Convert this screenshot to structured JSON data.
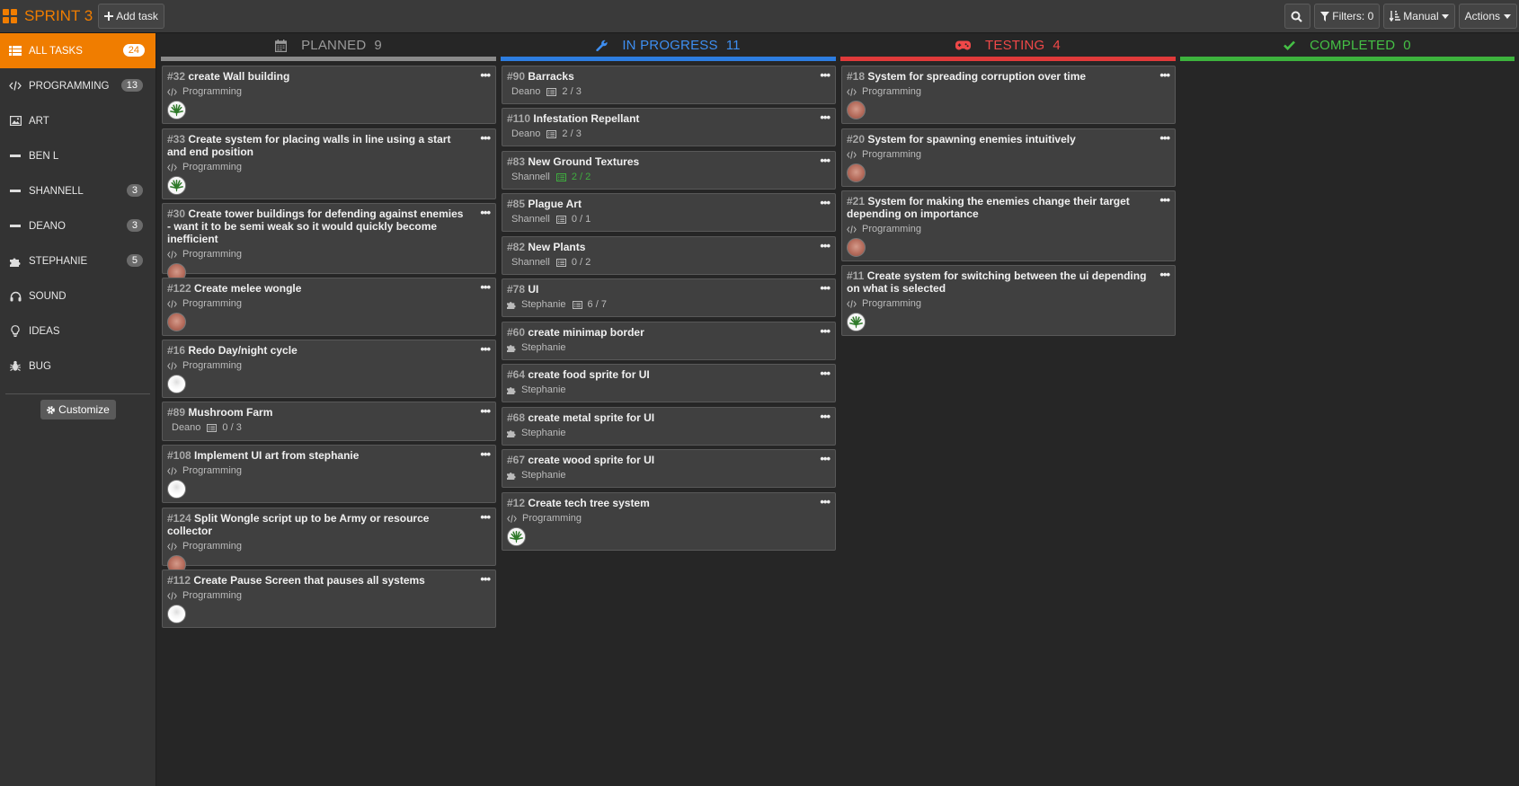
{
  "app": {
    "title": "SPRINT 3",
    "add_task": "Add task",
    "filters": "Filters: 0",
    "sort": "Manual",
    "actions": "Actions"
  },
  "sidebar": {
    "items": [
      {
        "label": "ALL TASKS",
        "count": "24",
        "icon": "table-icon",
        "active": true
      },
      {
        "label": "PROGRAMMING",
        "count": "13",
        "icon": "code-icon"
      },
      {
        "label": "ART",
        "count": "",
        "icon": "image-icon"
      },
      {
        "label": "BEN L",
        "count": "",
        "icon": "minus-icon"
      },
      {
        "label": "SHANNELL",
        "count": "3",
        "icon": "minus-icon"
      },
      {
        "label": "DEANO",
        "count": "3",
        "icon": "minus-icon"
      },
      {
        "label": "STEPHANIE",
        "count": "5",
        "icon": "puzzle-icon"
      },
      {
        "label": "SOUND",
        "count": "",
        "icon": "headphones-icon"
      },
      {
        "label": "IDEAS",
        "count": "",
        "icon": "lightbulb-icon"
      },
      {
        "label": "BUG",
        "count": "",
        "icon": "bug-icon"
      }
    ],
    "customize": "Customize"
  },
  "columns": [
    {
      "title": "PLANNED",
      "count": "9",
      "color": "#8a8a8a",
      "text_color": "#9a9a9a",
      "icon": "calendar-icon"
    },
    {
      "title": "IN PROGRESS",
      "count": "11",
      "color": "#2d7de0",
      "text_color": "#3e8ef0",
      "icon": "wrench-icon"
    },
    {
      "title": "TESTING",
      "count": "4",
      "color": "#e03a3a",
      "text_color": "#f04848",
      "icon": "gamepad-icon"
    },
    {
      "title": "COMPLETED",
      "count": "0",
      "color": "#3db33d",
      "text_color": "#45c045",
      "icon": "check-icon"
    }
  ],
  "cards": {
    "planned": [
      {
        "num": "#32",
        "title": "create Wall building",
        "tag": "Programming",
        "tag_icon": "code",
        "avatar": "weed"
      },
      {
        "num": "#33",
        "title": "Create system for placing walls in line using a start and end position",
        "tag": "Programming",
        "tag_icon": "code",
        "avatar": "weed"
      },
      {
        "num": "#30",
        "title": "Create tower buildings for defending against enemies - want it to be semi weak so it would quickly become inefficient",
        "tag": "Programming",
        "tag_icon": "code",
        "avatar": "face"
      },
      {
        "num": "#122",
        "title": "Create melee wongle",
        "tag": "Programming",
        "tag_icon": "code",
        "avatar": "face"
      },
      {
        "num": "#16",
        "title": "Redo Day/night cycle",
        "tag": "Programming",
        "tag_icon": "code",
        "avatar": "white"
      },
      {
        "num": "#89",
        "title": "Mushroom Farm",
        "tag": "Deano",
        "tag_icon": "none",
        "checklist": "0 / 3"
      },
      {
        "num": "#108",
        "title": "Implement UI art from stephanie",
        "tag": "Programming",
        "tag_icon": "code",
        "avatar": "white"
      },
      {
        "num": "#124",
        "title": "Split Wongle script up to be Army or resource collector",
        "tag": "Programming",
        "tag_icon": "code",
        "avatar": "face"
      },
      {
        "num": "#112",
        "title": "Create Pause Screen that pauses all systems",
        "tag": "Programming",
        "tag_icon": "code",
        "avatar": "white"
      }
    ],
    "in_progress": [
      {
        "num": "#90",
        "title": "Barracks",
        "tag": "Deano",
        "tag_icon": "none",
        "checklist": "2 / 3"
      },
      {
        "num": "#110",
        "title": "Infestation Repellant",
        "tag": "Deano",
        "tag_icon": "none",
        "checklist": "2 / 3"
      },
      {
        "num": "#83",
        "title": "New Ground Textures",
        "tag": "Shannell",
        "tag_icon": "none",
        "checklist": "2 / 2",
        "done": true
      },
      {
        "num": "#85",
        "title": "Plague Art",
        "tag": "Shannell",
        "tag_icon": "none",
        "checklist": "0 / 1"
      },
      {
        "num": "#82",
        "title": "New Plants",
        "tag": "Shannell",
        "tag_icon": "none",
        "checklist": "0 / 2"
      },
      {
        "num": "#78",
        "title": "UI",
        "tag": "Stephanie",
        "tag_icon": "puzzle",
        "checklist": "6 / 7"
      },
      {
        "num": "#60",
        "title": "create minimap border",
        "tag": "Stephanie",
        "tag_icon": "puzzle"
      },
      {
        "num": "#64",
        "title": "create food sprite for UI",
        "tag": "Stephanie",
        "tag_icon": "puzzle"
      },
      {
        "num": "#68",
        "title": "create metal sprite for UI",
        "tag": "Stephanie",
        "tag_icon": "puzzle"
      },
      {
        "num": "#67",
        "title": "create wood sprite for UI",
        "tag": "Stephanie",
        "tag_icon": "puzzle"
      },
      {
        "num": "#12",
        "title": "Create tech tree system",
        "tag": "Programming",
        "tag_icon": "code",
        "avatar": "weed"
      }
    ],
    "testing": [
      {
        "num": "#18",
        "title": "System for spreading corruption over time",
        "tag": "Programming",
        "tag_icon": "code",
        "avatar": "face"
      },
      {
        "num": "#20",
        "title": "System for spawning enemies intuitively",
        "tag": "Programming",
        "tag_icon": "code",
        "avatar": "face"
      },
      {
        "num": "#21",
        "title": "System for making the enemies change their target depending on importance",
        "tag": "Programming",
        "tag_icon": "code",
        "avatar": "face"
      },
      {
        "num": "#11",
        "title": "Create system for switching between the ui depending on what is selected",
        "tag": "Programming",
        "tag_icon": "code",
        "avatar": "weed"
      }
    ],
    "completed": []
  }
}
